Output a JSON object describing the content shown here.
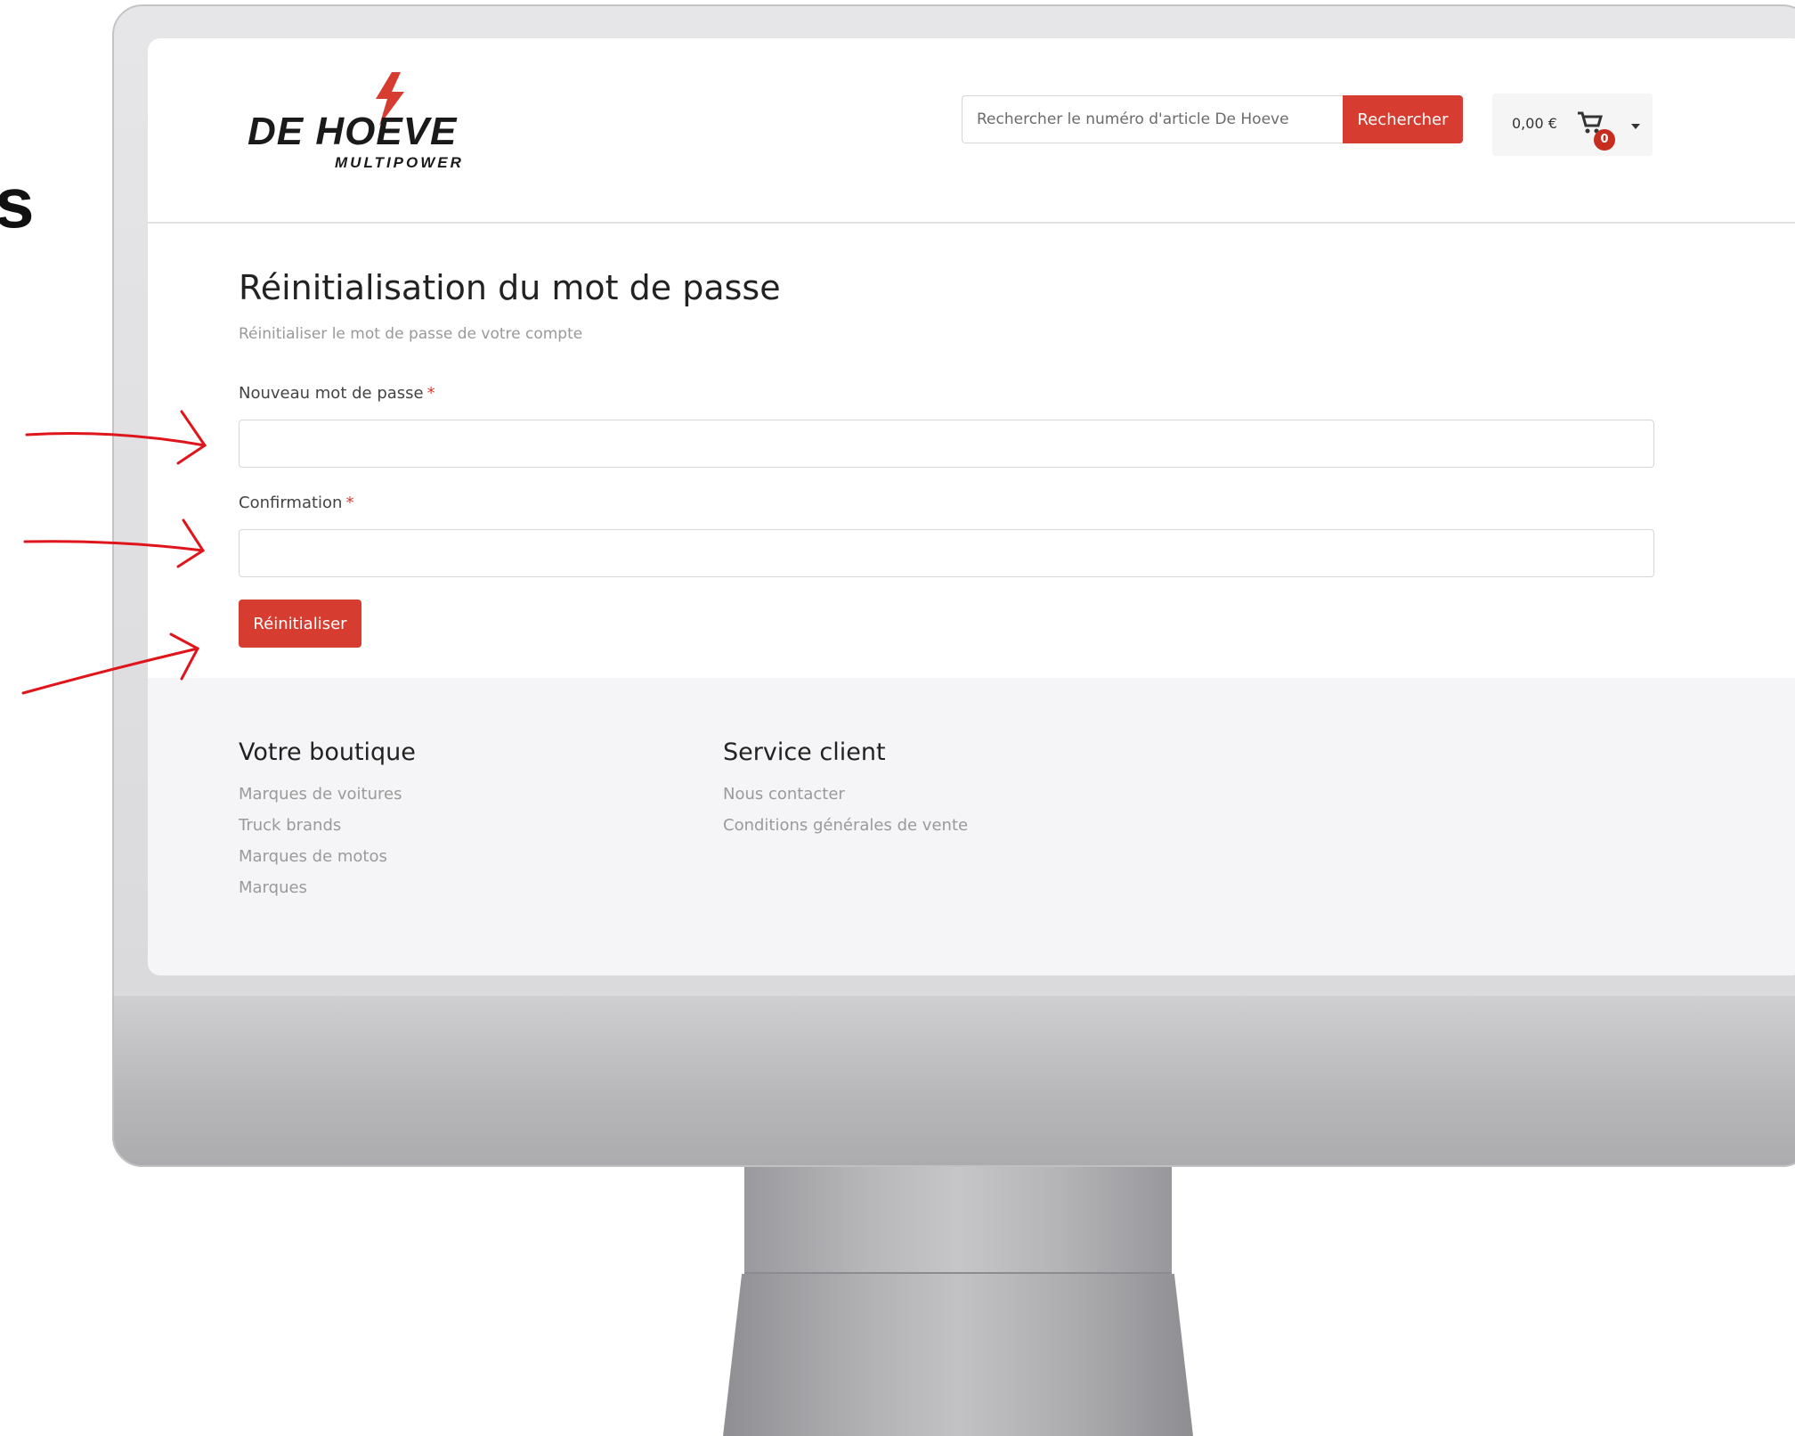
{
  "edge_text": "s",
  "logo": {
    "primary": "DE HOEVE",
    "secondary": "MULTIPOWER"
  },
  "header": {
    "search_placeholder": "Rechercher le numéro d'article De Hoeve",
    "search_button": "Rechercher",
    "cart_total": "0,00 €",
    "cart_count": "0"
  },
  "main": {
    "title": "Réinitialisation du mot de passe",
    "subtitle": "Réinitialiser le mot de passe de votre compte",
    "new_password_label": "Nouveau mot de passe",
    "confirmation_label": "Confirmation",
    "required_mark": "*",
    "submit_label": "Réinitialiser"
  },
  "footer": {
    "shop_heading": "Votre boutique",
    "shop_links": [
      "Marques de voitures",
      "Truck brands",
      "Marques de motos",
      "Marques"
    ],
    "service_heading": "Service client",
    "service_links": [
      "Nous contacter",
      "Conditions générales de vente"
    ]
  },
  "colors": {
    "accent": "#d63c30",
    "annotation": "#e0151c",
    "footer_bg": "#f5f5f7"
  }
}
